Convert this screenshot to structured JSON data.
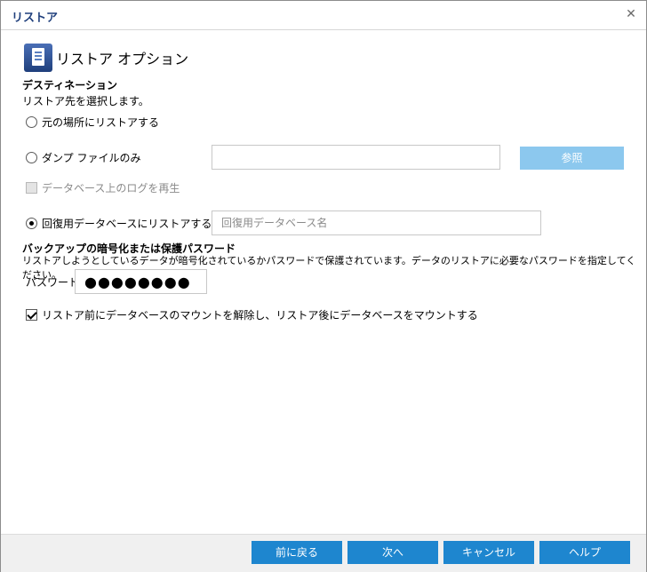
{
  "window": {
    "title": "リストア"
  },
  "header": {
    "title": "リストア オプション"
  },
  "destination": {
    "section_title": "デスティネーション",
    "instruction": "リストア先を選択します。",
    "option_original": "元の場所にリストアする",
    "option_dump": "ダンプ ファイルのみ",
    "browse_label": "参照",
    "replay_logs": "データベース上のログを再生",
    "option_recovery": "回復用データベースにリストアする",
    "recovery_placeholder": "回復用データベース名",
    "selected": "option_recovery"
  },
  "encryption": {
    "section_title": "バックアップの暗号化または保護パスワード",
    "description": "リストアしようとしているデータが暗号化されているかパスワードで保護されています。データのリストアに必要なパスワードを指定してください。",
    "password_label": "パスワード",
    "password_value": "●●●●●●●●"
  },
  "mount_option": {
    "label": "リストア前にデータベースのマウントを解除し、リストア後にデータベースをマウントする",
    "checked": true
  },
  "footer": {
    "back": "前に戻る",
    "next": "次へ",
    "cancel": "キャンセル",
    "help": "ヘルプ"
  },
  "colors": {
    "button": "#1e86cf",
    "button_disabled": "#8cc8ee",
    "title": "#1f3f7c"
  }
}
